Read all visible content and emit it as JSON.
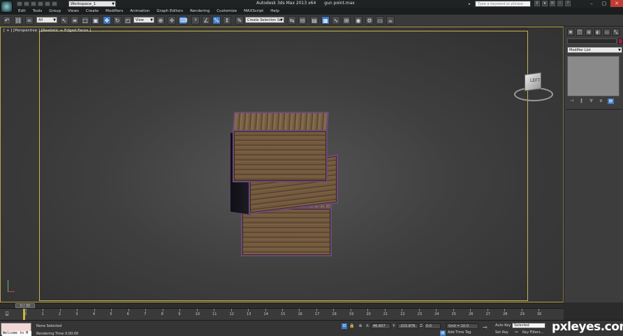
{
  "title_bar": {
    "workspace": "Workspace_1",
    "app_title": "Autodesk 3ds Max  2013 x64",
    "file_name": "gun point.max",
    "search_placeholder": "Type a keyword or phrase"
  },
  "menu": [
    "Edit",
    "Tools",
    "Group",
    "Views",
    "Create",
    "Modifiers",
    "Animation",
    "Graph Editors",
    "Rendering",
    "Customize",
    "MAXScript",
    "Help"
  ],
  "toolbar": {
    "selection_filter": "All",
    "reference_coord": "View",
    "named_selection_placeholder": "Create Selection Se",
    "active_tool": "move-icon"
  },
  "viewport": {
    "label": "[ + ] [Perspective ] [Realistic + Edged Faces ]",
    "viewcube_face": "LEFT",
    "frame_color": "#c4b551",
    "selection_edge_color": "#6a4a7a"
  },
  "command_panel": {
    "modifier_list": "Modifier List",
    "object_color": "#9c1d4e"
  },
  "timeline": {
    "position": "0 / 30",
    "ticks": [
      "0",
      "1",
      "2",
      "3",
      "4",
      "5",
      "6",
      "7",
      "8",
      "9",
      "10",
      "11",
      "12",
      "13",
      "14",
      "15",
      "16",
      "17",
      "18",
      "19",
      "20",
      "21",
      "22",
      "23",
      "24",
      "25",
      "26",
      "27",
      "28",
      "29",
      "30"
    ]
  },
  "status": {
    "maxscript_line": "Welcome to M",
    "selection_status": "None Selected",
    "rendering_time": "Rendering Time  0:00:00",
    "x_label": "X:",
    "x_value": "46.607",
    "y_label": "Y:",
    "y_value": "-215.876",
    "z_label": "Z:",
    "z_value": "0.0",
    "grid": "Grid = 10.0",
    "add_time_tag": "Add Time Tag",
    "auto_key": "Auto Key",
    "set_key": "Set Key",
    "key_mode": "Selected",
    "key_filters": "Key Filters..."
  },
  "watermark": "pxleyes.com"
}
